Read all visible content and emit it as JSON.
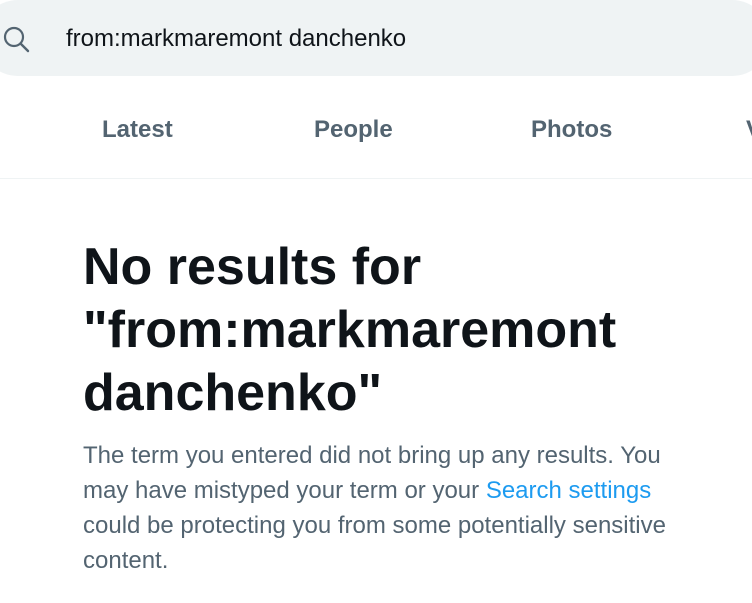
{
  "search": {
    "query": "from:markmaremont danchenko",
    "icon": "search-icon"
  },
  "tabs": [
    {
      "label": "Latest"
    },
    {
      "label": "People"
    },
    {
      "label": "Photos"
    },
    {
      "label": "V"
    }
  ],
  "empty_state": {
    "title_line1": "No results for",
    "title_line2": "\"from:markmaremont",
    "title_line3": "danchenko\"",
    "body_before_link": "The term you entered did not bring up any results. You may have mistyped your term or your ",
    "link_text": "Search settings",
    "body_after_link": " could be protecting you from some potentially sensitive content."
  },
  "colors": {
    "accent": "#1d9bf0",
    "secondary_text": "#536471",
    "primary_text": "#0f1419",
    "search_background": "#eff3f4"
  }
}
